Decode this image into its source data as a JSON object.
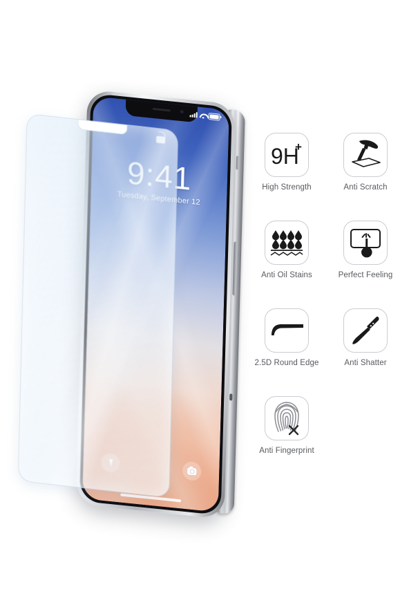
{
  "product": {
    "type": "tempered-glass-screen-protector",
    "phone": {
      "lockscreen": {
        "time": "9:41",
        "date": "Tuesday, September 12",
        "lock_icon": "unlocked-padlock-icon",
        "statusbar": {
          "signal_icon": "cellular-signal-icon",
          "signal_bars": 4,
          "wifi_icon": "wifi-icon",
          "battery_icon": "battery-full-icon"
        },
        "quick_actions": [
          {
            "name": "flashlight-icon",
            "label": "Flashlight"
          },
          {
            "name": "camera-icon",
            "label": "Camera"
          }
        ],
        "home_indicator": "home-indicator-bar"
      },
      "hardware": {
        "notch": "front-camera-notch",
        "power_button": "power-button",
        "mute_switch": "mute-switch",
        "volume_button": "volume-button"
      }
    },
    "glass_overlay": {
      "name": "tempered-glass-sheet",
      "notch_cutout": "notch-cutout"
    }
  },
  "features": [
    {
      "icon": "9h-hardness-icon",
      "label": "High Strength",
      "value": "9H",
      "superscript": "+"
    },
    {
      "icon": "hammer-icon",
      "label": "Anti Scratch"
    },
    {
      "icon": "oil-droplets-icon",
      "label": "Anti Oil Stains"
    },
    {
      "icon": "finger-tap-icon",
      "label": "Perfect Feeling"
    },
    {
      "icon": "round-edge-icon",
      "label": "2.5D Round Edge"
    },
    {
      "icon": "knife-icon",
      "label": "Anti Shatter"
    },
    {
      "icon": "fingerprint-icon",
      "label": "Anti Fingerprint"
    }
  ],
  "colors": {
    "background": "#ffffff",
    "icon_border": "#c9ccd1",
    "label_text": "#57595d",
    "icon_fill": "#1a1a1a",
    "glass_tint": "#e2eefa",
    "wallpaper_top": "#2f4fae",
    "wallpaper_bottom": "#ef9f7d"
  }
}
